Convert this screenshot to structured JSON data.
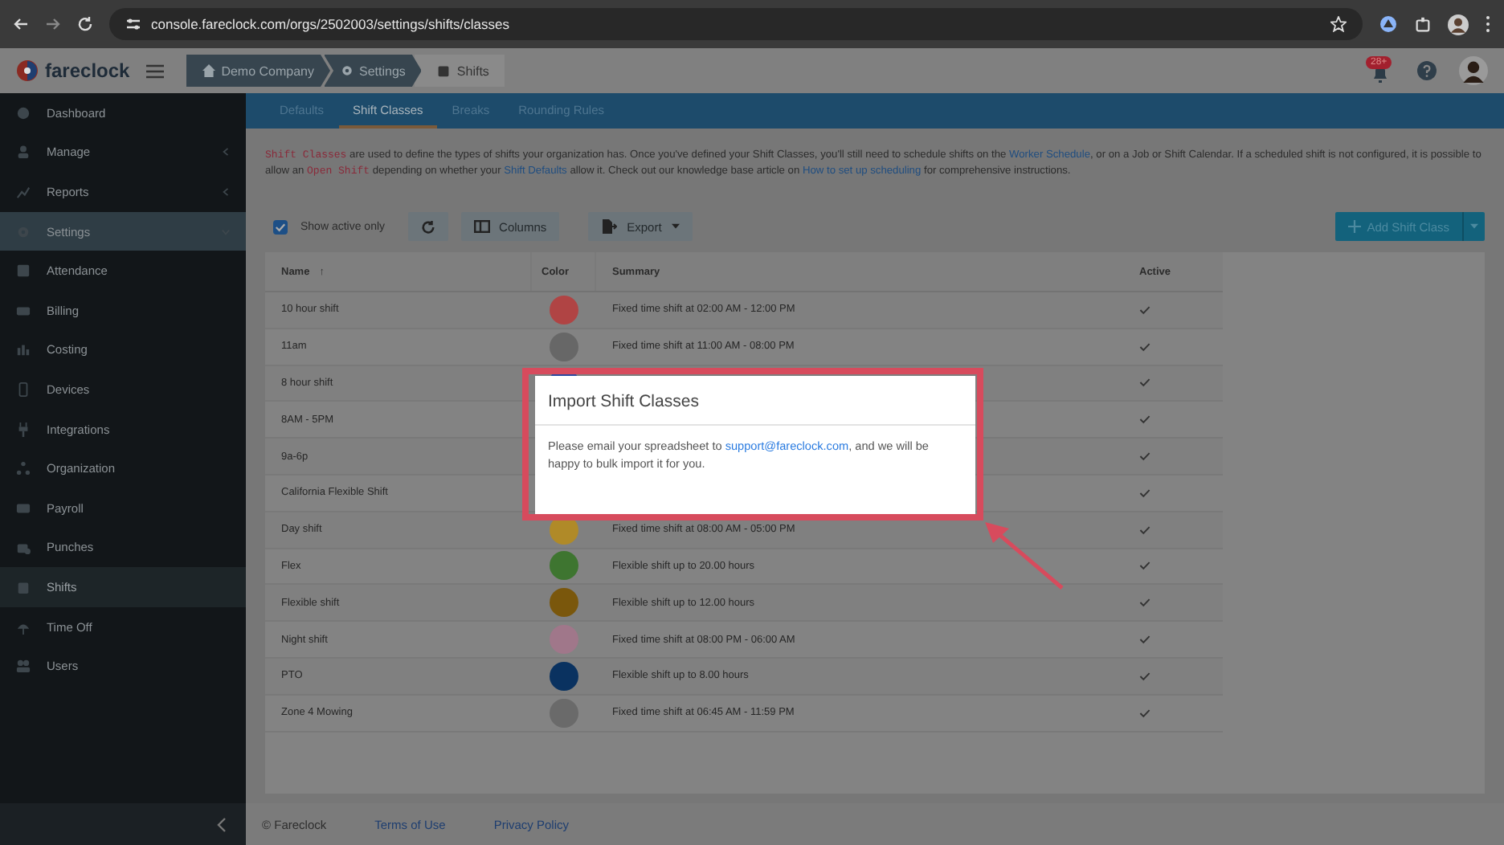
{
  "browser": {
    "url": "console.fareclock.com/orgs/2502003/settings/shifts/classes"
  },
  "header": {
    "logo": "fareclock",
    "breadcrumbs": [
      {
        "label": "Demo Company",
        "kind": "home"
      },
      {
        "label": "Settings",
        "kind": "settings"
      },
      {
        "label": "Shifts",
        "kind": "shifts"
      }
    ],
    "notification_badge": "28+"
  },
  "sidebar": {
    "items": [
      {
        "label": "Dashboard",
        "selected": false
      },
      {
        "label": "Manage",
        "selected": false,
        "expanded": false
      },
      {
        "label": "Reports",
        "selected": false,
        "expanded": false
      },
      {
        "label": "Settings",
        "selected": false,
        "expanded": true
      },
      {
        "label": "Attendance",
        "selected": false
      },
      {
        "label": "Billing",
        "selected": false
      },
      {
        "label": "Costing",
        "selected": false
      },
      {
        "label": "Devices",
        "selected": false
      },
      {
        "label": "Integrations",
        "selected": false
      },
      {
        "label": "Organization",
        "selected": false
      },
      {
        "label": "Payroll",
        "selected": false
      },
      {
        "label": "Punches",
        "selected": false
      },
      {
        "label": "Shifts",
        "selected": true
      },
      {
        "label": "Time Off",
        "selected": false
      },
      {
        "label": "Users",
        "selected": false
      }
    ]
  },
  "tabs": [
    {
      "label": "Defaults",
      "selected": false
    },
    {
      "label": "Shift Classes",
      "selected": true
    },
    {
      "label": "Breaks",
      "selected": false
    },
    {
      "label": "Rounding Rules",
      "selected": false
    }
  ],
  "intro": [
    {
      "kind": "code",
      "text": "Shift Classes"
    },
    {
      "kind": "text",
      "text": " are used to define the types of shifts your organization has. Once you've defined your Shift Classes, you'll still need to schedule shifts on the "
    },
    {
      "kind": "link",
      "text": "Worker Schedule"
    },
    {
      "kind": "text",
      "text": ", or on a Job or Shift Calendar. If a scheduled shift is not configured, it is possible to allow an "
    },
    {
      "kind": "code",
      "text": "Open Shift"
    },
    {
      "kind": "text",
      "text": " depending on whether your "
    },
    {
      "kind": "link",
      "text": "Shift Defaults"
    },
    {
      "kind": "text",
      "text": " allow it. Check out our knowledge base article on "
    },
    {
      "kind": "link",
      "text": "How to set up scheduling"
    },
    {
      "kind": "text",
      "text": " for comprehensive instructions."
    }
  ],
  "toolbar": {
    "show_active_only": {
      "label": "Show active only",
      "checked": true
    },
    "columns_button": "Columns",
    "export_button": "Export",
    "add_button": "Add Shift Class"
  },
  "table": {
    "columns": [
      {
        "label": "Name",
        "sort_indicator": "↑"
      },
      {
        "label": "Color"
      },
      {
        "label": "Summary"
      },
      {
        "label": "Active"
      }
    ],
    "rows": [
      {
        "name": "10 hour shift",
        "color": "#b04444",
        "summary": "Fixed time shift at 02:00 AM - 12:00 PM",
        "active": true
      },
      {
        "name": "11am",
        "color": "#676767",
        "summary": "Fixed time shift at 11:00 AM - 08:00 PM",
        "active": true
      },
      {
        "name": "8 hour shift",
        "color": "#2a4aa0",
        "active": true
      },
      {
        "name": "8AM - 5PM",
        "active": true
      },
      {
        "name": "9a-6p",
        "active": true
      },
      {
        "name": "California Flexible Shift",
        "active": true
      },
      {
        "name": "Day shift",
        "color": "#b08a28",
        "summary": "Fixed time shift at 08:00 AM - 05:00 PM",
        "active": true
      },
      {
        "name": "Flex",
        "color": "#3e7530",
        "summary": "Flexible shift up to 20.00 hours",
        "active": true
      },
      {
        "name": "Flexible shift",
        "color": "#7a570c",
        "summary": "Flexible shift up to 12.00 hours",
        "active": true
      },
      {
        "name": "Night shift",
        "color": "#a0778a",
        "summary": "Fixed time shift at 08:00 PM - 06:00 AM",
        "active": true
      },
      {
        "name": "PTO",
        "color": "#0a3260",
        "summary": "Flexible shift up to 8.00 hours",
        "active": true
      },
      {
        "name": "Zone 4 Mowing",
        "color": "#6a6a6a",
        "summary": "Fixed time shift at 06:45 AM - 11:59 PM",
        "active": true
      }
    ]
  },
  "modal": {
    "title": "Import Shift Classes",
    "body": [
      {
        "kind": "text",
        "text": "Please email your spreadsheet to "
      },
      {
        "kind": "link",
        "text": "support@fareclock.com"
      },
      {
        "kind": "text",
        "text": ", and we will be happy to bulk import it for you."
      }
    ]
  },
  "footer": {
    "copyright": "© Fareclock",
    "links": [
      "Terms of Use",
      "Privacy Policy"
    ]
  }
}
